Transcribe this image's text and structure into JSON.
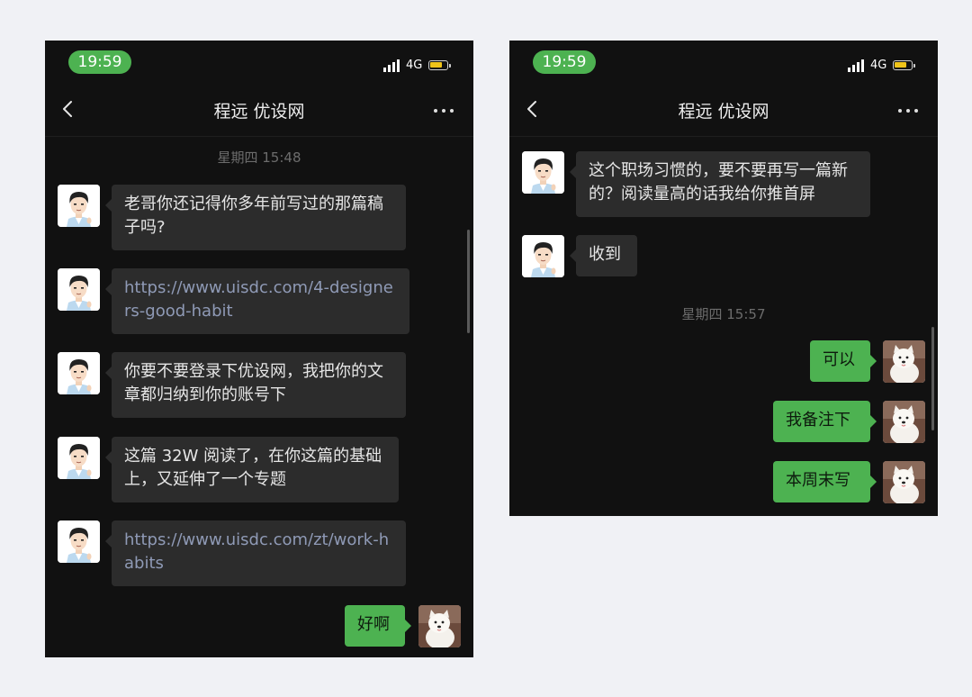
{
  "colors": {
    "accent_green": "#4db251",
    "bubble_dark": "#2c2c2c",
    "link_text": "#8f9ab6"
  },
  "left_phone": {
    "status": {
      "time": "19:59",
      "network": "4G"
    },
    "nav": {
      "title": "程远 优设网",
      "back_icon": "chevron-left-icon",
      "more_icon": "more-dots-icon"
    },
    "timestamp": "星期四 15:48",
    "messages": [
      {
        "from": "other",
        "text": "老哥你还记得你多年前写过的那篇稿子吗?"
      },
      {
        "from": "other",
        "text": "https://www.uisdc.com/4-designers-good-habit",
        "is_link": true
      },
      {
        "from": "other",
        "text": "你要不要登录下优设网，我把你的文章都归纳到你的账号下"
      },
      {
        "from": "other",
        "text": "这篇 32W 阅读了，在你这篇的基础上，又延伸了一个专题"
      },
      {
        "from": "other",
        "text": "https://www.uisdc.com/zt/work-habits",
        "is_link": true
      },
      {
        "from": "me",
        "text": "好啊"
      }
    ]
  },
  "right_phone": {
    "status": {
      "time": "19:59",
      "network": "4G"
    },
    "nav": {
      "title": "程远 优设网",
      "back_icon": "chevron-left-icon",
      "more_icon": "more-dots-icon"
    },
    "messages_before": [
      {
        "from": "other",
        "text": "这个职场习惯的，要不要再写一篇新的？阅读量高的话我给你推首屏"
      },
      {
        "from": "other",
        "text": "收到"
      }
    ],
    "timestamp": "星期四 15:57",
    "messages_after": [
      {
        "from": "me",
        "text": "可以"
      },
      {
        "from": "me",
        "text": "我备注下"
      },
      {
        "from": "me",
        "text": "本周末写"
      }
    ]
  }
}
